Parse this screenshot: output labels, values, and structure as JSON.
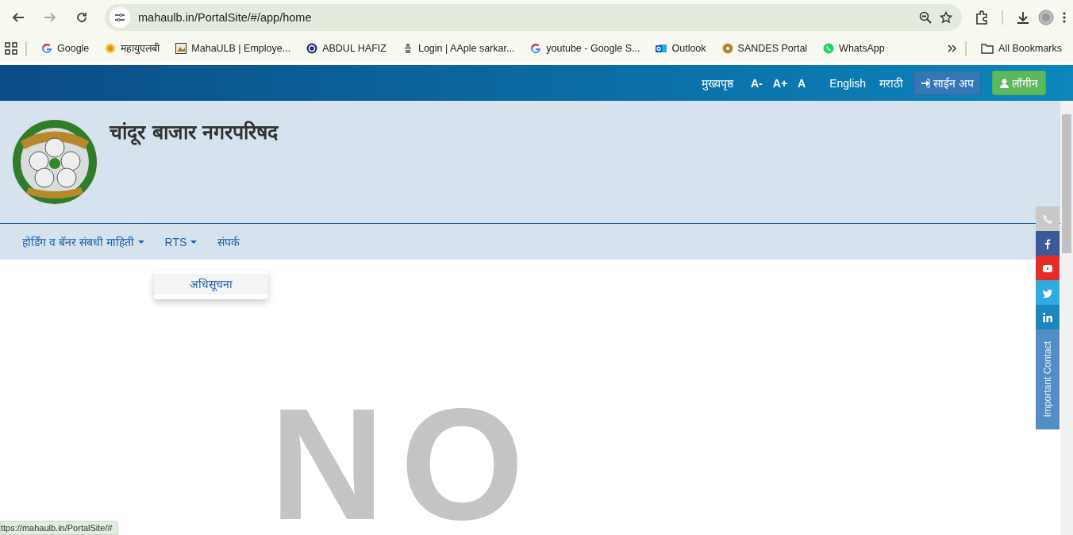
{
  "browser": {
    "url": "mahaulb.in/PortalSite/#/app/home",
    "bookmarks": [
      {
        "label": "Google",
        "kind": "google"
      },
      {
        "label": "महायुएलबी",
        "kind": "seal"
      },
      {
        "label": "MahaULB | Employe...",
        "kind": "picture"
      },
      {
        "label": "ABDUL HAFIZ",
        "kind": "ring"
      },
      {
        "label": "Login | AAple sarkar...",
        "kind": "emblem"
      },
      {
        "label": "youtube - Google S...",
        "kind": "google"
      },
      {
        "label": "Outlook",
        "kind": "outlook"
      },
      {
        "label": "SANDES Portal",
        "kind": "sandes"
      },
      {
        "label": "WhatsApp",
        "kind": "whatsapp"
      }
    ],
    "all_bookmarks": "All Bookmarks",
    "status_url": "ttps://mahaulb.in/PortalSite/#"
  },
  "topbar": {
    "home": "मुख्यपृष्ठ",
    "font_sizes": [
      "A-",
      "A+",
      "A"
    ],
    "languages": [
      "English",
      "मराठी"
    ],
    "signup": "साईन अप",
    "login": "लॉगीन"
  },
  "site": {
    "title": "चांदूर बाजार नगरपरिषद"
  },
  "nav": [
    {
      "label": "होर्डिंग व बॅनर संबधी माहिती",
      "dropdown": true
    },
    {
      "label": "RTS",
      "dropdown": true,
      "expanded": true,
      "children": [
        {
          "label": "अधिसूचना"
        }
      ]
    },
    {
      "label": "संपर्क",
      "dropdown": false
    }
  ],
  "placeholder_text": "NO",
  "social": [
    {
      "kind": "phone"
    },
    {
      "kind": "facebook"
    },
    {
      "kind": "youtube"
    },
    {
      "kind": "twitter"
    },
    {
      "kind": "linkedin"
    }
  ],
  "important_contact": "Important Contact"
}
